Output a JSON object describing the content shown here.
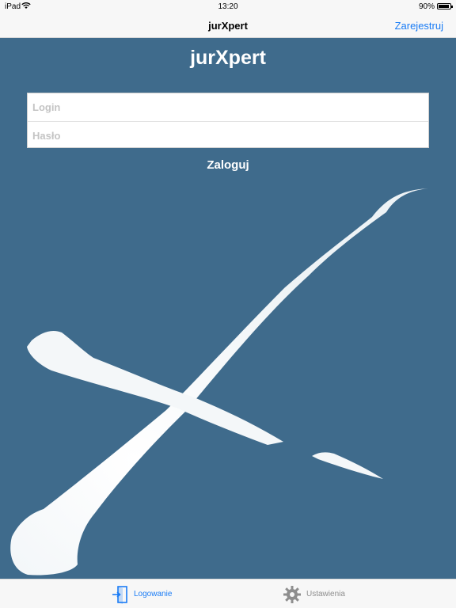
{
  "status_bar": {
    "device": "iPad",
    "time": "13:20",
    "battery": "90%",
    "battery_level": 0.9
  },
  "nav": {
    "title": "jurXpert",
    "register_label": "Zarejestruj"
  },
  "app_title": "jurXpert",
  "form": {
    "login_placeholder": "Login",
    "password_placeholder": "Hasło",
    "login_value": "",
    "password_value": ""
  },
  "login_button": "Zaloguj",
  "tabs": [
    {
      "label": "Logowanie",
      "icon": "door-icon",
      "active": true
    },
    {
      "label": "Ustawienia",
      "icon": "gear-icon",
      "active": false
    }
  ],
  "colors": {
    "background": "#3f6b8c",
    "accent": "#1a7cf5",
    "logo": "#f4f7f9",
    "bars": "#f7f7f7"
  }
}
